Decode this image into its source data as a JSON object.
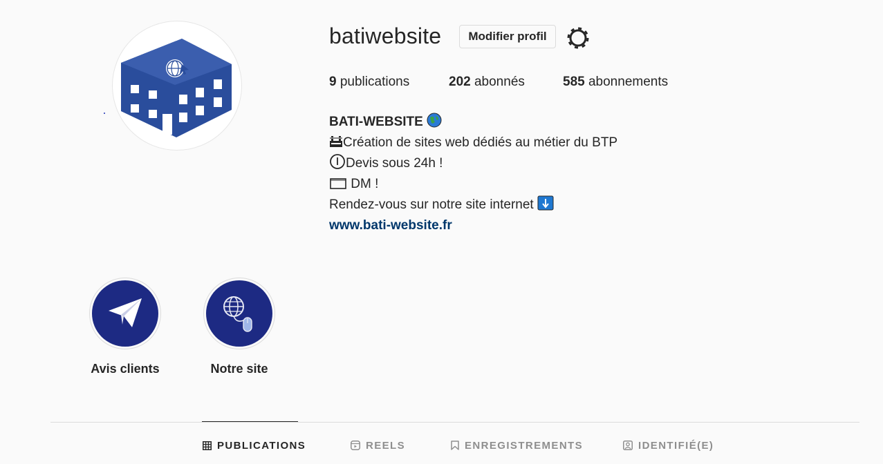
{
  "profile": {
    "username": "batiwebsite",
    "edit_button": "Modifier profil",
    "settings_icon": "gear-icon"
  },
  "stats": {
    "posts_count": "9",
    "posts_label": "publications",
    "followers_count": "202",
    "followers_label": "abonnés",
    "following_count": "585",
    "following_label": "abonnements"
  },
  "bio": {
    "name": "BATI-WEBSITE",
    "line1": "Création de sites web dédiés au métier du BTP",
    "line2": "Devis sous 24h !",
    "line3": " DM !",
    "line4": "Rendez-vous sur notre site internet ",
    "link": "www.bati-website.fr"
  },
  "highlights": [
    {
      "label": "Avis clients",
      "icon": "paper-plane-icon"
    },
    {
      "label": "Notre site",
      "icon": "globe-mouse-icon"
    }
  ],
  "tabs": [
    {
      "label": "PUBLICATIONS",
      "icon": "grid-icon",
      "active": true
    },
    {
      "label": "REELS",
      "icon": "reels-icon",
      "active": false
    },
    {
      "label": "ENREGISTREMENTS",
      "icon": "bookmark-icon",
      "active": false
    },
    {
      "label": "IDENTIFIÉ(E)",
      "icon": "tagged-user-icon",
      "active": false
    }
  ],
  "colors": {
    "brand_blue": "#1d2a83",
    "logo_blue": "#2a4d9c",
    "link": "#00376b"
  }
}
